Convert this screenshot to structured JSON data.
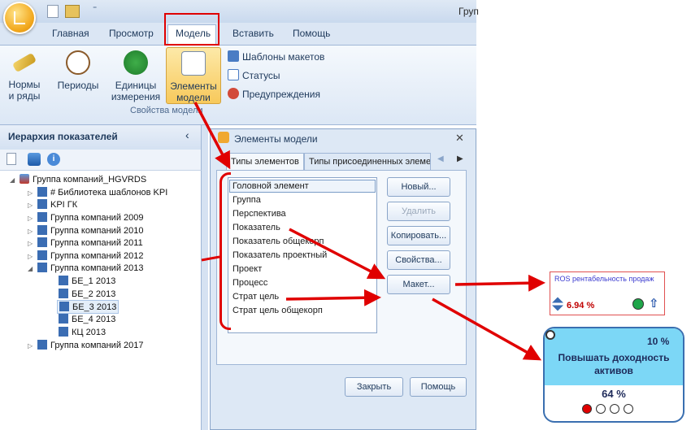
{
  "window": {
    "title": "Груп"
  },
  "tabs": [
    {
      "label": "Главная"
    },
    {
      "label": "Просмотр"
    },
    {
      "label": "Модель"
    },
    {
      "label": "Вставить"
    },
    {
      "label": "Помощь"
    }
  ],
  "ribbon": {
    "buttons": [
      {
        "label": "Нормы\nи ряды",
        "line1": "Нормы",
        "line2": "и ряды"
      },
      {
        "label": "Периоды",
        "line1": "Периоды",
        "line2": ""
      },
      {
        "label": "Единицы измерения",
        "line1": "Единицы",
        "line2": "измерения"
      },
      {
        "label": "Элементы модели",
        "line1": "Элементы",
        "line2": "модели"
      }
    ],
    "small_buttons": [
      {
        "label": "Шаблоны макетов",
        "icon": "layout-templates-icon"
      },
      {
        "label": "Статусы",
        "icon": "statuses-icon"
      },
      {
        "label": "Предупреждения",
        "icon": "warnings-icon"
      }
    ],
    "group_label": "Свойства модели"
  },
  "left_panel": {
    "title": "Иерархия показателей",
    "collapse": "‹",
    "tree": [
      {
        "label": "Группа компаний_HGVRDS",
        "level": 0,
        "expanded": true
      },
      {
        "label": "# Библиотека шаблонов KPI",
        "level": 1
      },
      {
        "label": "KPI ГК",
        "level": 1
      },
      {
        "label": "Группа компаний 2009",
        "level": 1
      },
      {
        "label": "Группа компаний 2010",
        "level": 1
      },
      {
        "label": "Группа компаний 2011",
        "level": 1
      },
      {
        "label": "Группа компаний 2012",
        "level": 1
      },
      {
        "label": "Группа компаний 2013",
        "level": 1,
        "expanded": true
      },
      {
        "label": "БЕ_1 2013",
        "level": 2
      },
      {
        "label": "БЕ_2 2013",
        "level": 2
      },
      {
        "label": "БЕ_3 2013",
        "level": 2,
        "selected": true
      },
      {
        "label": "БЕ_4 2013",
        "level": 2
      },
      {
        "label": "КЦ 2013",
        "level": 2
      },
      {
        "label": "Группа компаний 2017",
        "level": 1
      }
    ]
  },
  "dialog": {
    "title": "Элементы модели",
    "close": "✕",
    "tabs": [
      {
        "label": "Типы элементов"
      },
      {
        "label": "Типы присоединенных элемен"
      }
    ],
    "list": [
      "Головной элемент",
      "Группа",
      "Перспектива",
      "Показатель",
      "Показатель общекорп",
      "Показатель проектный",
      "Проект",
      "Процесс",
      "Страт цель",
      "Страт цель общекорп"
    ],
    "buttons": {
      "new": "Новый...",
      "delete": "Удалить",
      "copy": "Копировать...",
      "properties": "Свойства...",
      "layout": "Макет...",
      "close": "Закрыть",
      "help": "Помощь"
    }
  },
  "card_small": {
    "title": "ROS рентабельность продаж",
    "value": "6.94 %",
    "status_color": "#1fa64a"
  },
  "card_big": {
    "percent": "10 %",
    "title": "Повышать доходность активов",
    "value": "64 %",
    "dots": [
      "#e00000",
      "#ffffff",
      "#ffffff",
      "#ffffff"
    ]
  },
  "colors": {
    "accent_red": "#e00000",
    "card_blue": "#7cd7f6"
  }
}
